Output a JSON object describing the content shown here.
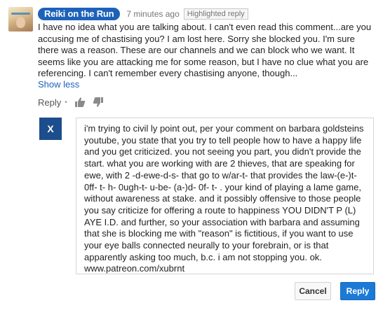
{
  "comment": {
    "author": "Reiki on the Run",
    "timestamp": "7 minutes ago",
    "highlight_badge": "Highlighted reply",
    "text": "I have no idea what you are talking about.  I can't even read this comment...are you accusing me of chastising you?  I am lost here.  Sorry she blocked you.  I'm sure there was a reason.  These are our channels and we can block who we want.  It seems like you are attacking me for some reason, but I have no clue what you are referencing.  I can't remember every chastising anyone, though...",
    "show_less": "Show less",
    "reply_label": "Reply",
    "separator": "•"
  },
  "reply_box": {
    "avatar_letter": "X",
    "text": "i'm trying to civil ly point out, per your comment on barbara goldsteins youtube, you state that you try to tell people how to have a happy life and you get criticized.  you not seeing you part, you didn't provide the start. what you are working with are 2 thieves, that are speaking for ewe, with 2 -d-ewe-d-s-  that go to w/ar-t-  that provides the law-(e-)t- 0ff- t- h- 0ugh-t- u-be- (a-)d- 0f- t- . your kind of playing a lame game, without awareness at stake. and it possibly offensive to those people you say criticize for offering a route to happiness YOU DIDN'T P (L) AYE I.D.   and further, so your association with barbara and assuming that she is blocking me with \"reason\"  is fictitious, if you want to use your eye balls connected neurally to your forebrain, or is that apparently asking too much, b.c. i am not stopping you. ok. www.patreon.com/xubrnt"
  },
  "buttons": {
    "cancel": "Cancel",
    "reply": "Reply"
  },
  "icons": {
    "like": "thumbs-up-icon",
    "dislike": "thumbs-down-icon"
  },
  "colors": {
    "accent": "#1c62b9",
    "reply_button": "#1c7ad6",
    "muted": "#767676"
  }
}
